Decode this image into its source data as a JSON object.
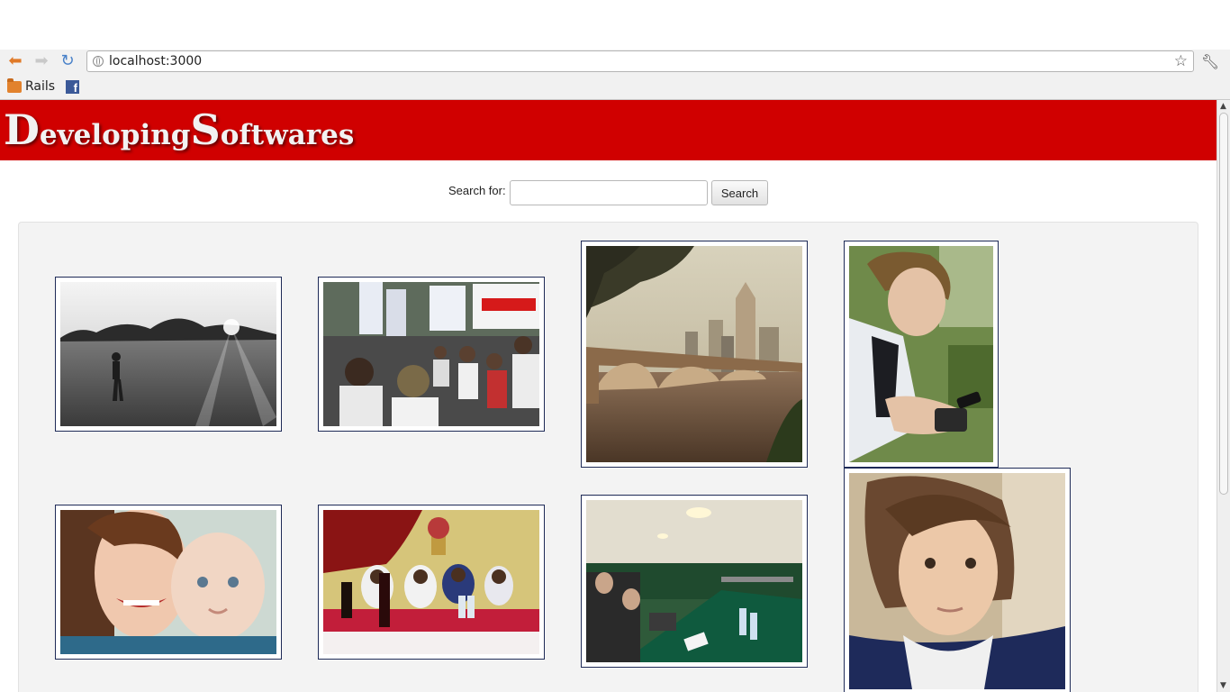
{
  "browser": {
    "url": "localhost:3000",
    "bookmarks": [
      {
        "label": "Rails",
        "icon": "folder-icon"
      },
      {
        "label": "",
        "icon": "facebook-icon"
      }
    ],
    "facebook_glyph": "f"
  },
  "header": {
    "logo_first_initial": "D",
    "logo_first_rest": "eveloping",
    "logo_second_initial": "S",
    "logo_second_rest": "oftwares",
    "banner_color": "#d00000"
  },
  "search": {
    "label": "Search for:",
    "value": "",
    "button_label": "Search"
  },
  "gallery": {
    "photos": [
      {
        "subject": "black-and-white field at sunset with child"
      },
      {
        "subject": "street march with UAEM flags"
      },
      {
        "subject": "city skyline behind arched stone bridge over river"
      },
      {
        "subject": "young man looking at phone outdoors"
      },
      {
        "subject": "smiling woman holding baby"
      },
      {
        "subject": "nuns seated at red draped table"
      },
      {
        "subject": "conference room meeting with green table"
      },
      {
        "subject": "young person selfie portrait"
      }
    ]
  }
}
